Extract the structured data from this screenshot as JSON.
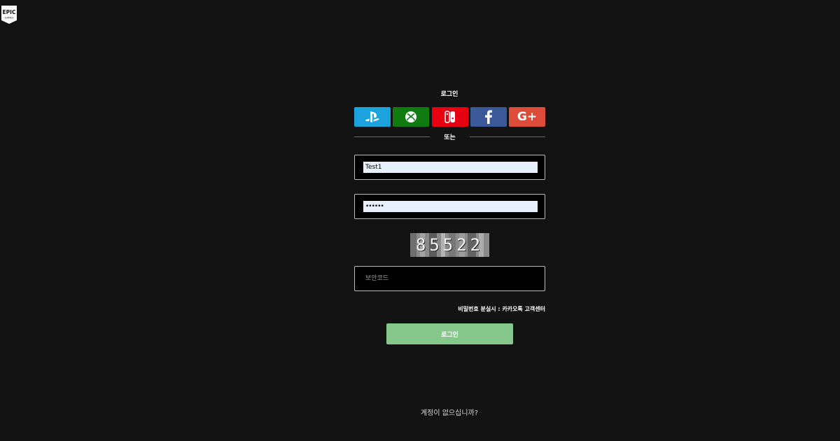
{
  "brand": {
    "logo_icon": "epic-games-logo-icon",
    "logo_line1": "EPIC",
    "logo_line2": "GAMES"
  },
  "login": {
    "heading": "로그인",
    "social": [
      {
        "name": "playstation",
        "icon": "playstation-icon",
        "color": "#1aa3dd"
      },
      {
        "name": "xbox",
        "icon": "xbox-icon",
        "color": "#107c10"
      },
      {
        "name": "nintendo",
        "icon": "nintendo-switch-icon",
        "color": "#e60012"
      },
      {
        "name": "facebook",
        "icon": "facebook-icon",
        "color": "#3b5998"
      },
      {
        "name": "google",
        "icon": "google-plus-icon",
        "color": "#dd4b39",
        "label": "G+"
      }
    ],
    "divider_text": "또는",
    "username_value": "Test1",
    "password_value": "••••••",
    "captcha_code": "85522",
    "security_placeholder": "보안코드",
    "help_text": "비밀번호 분실시 : 카카오톡 고객센터",
    "submit_label": "로그인",
    "signup_text": "계정이 없으십니까?"
  },
  "colors": {
    "background": "#121212",
    "accent_button": "#86c78c",
    "input_autofill": "#e8f0fe"
  }
}
